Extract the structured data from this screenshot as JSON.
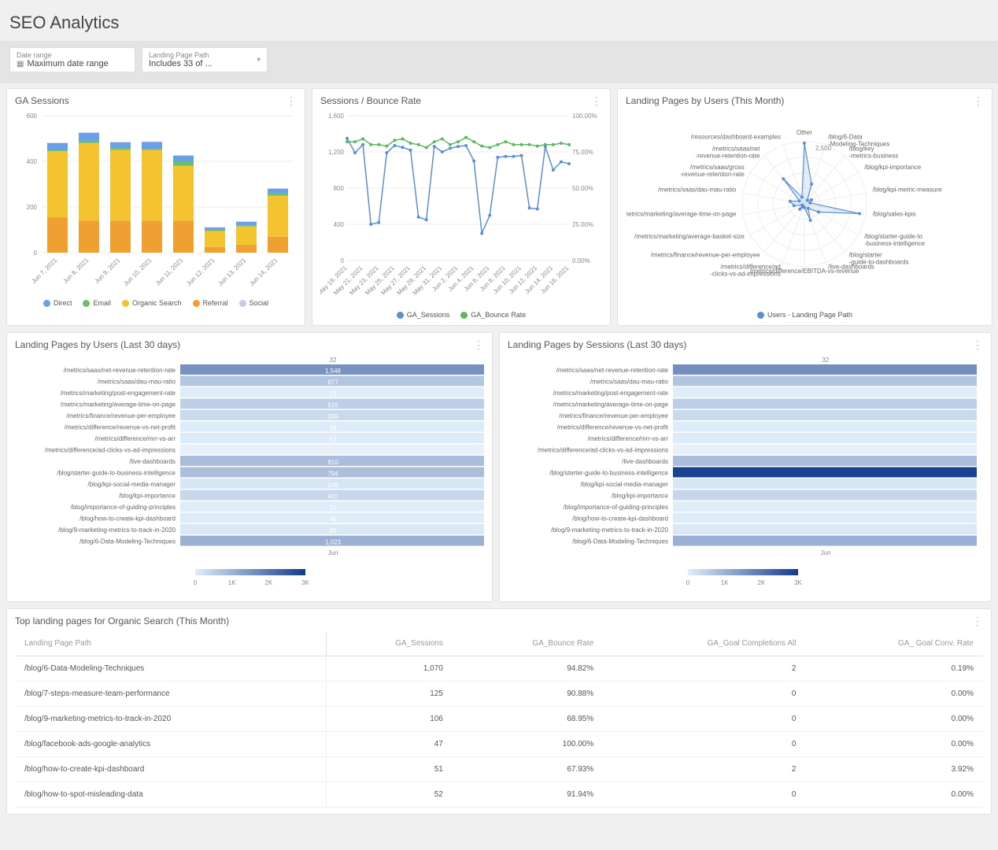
{
  "title": "SEO Analytics",
  "filters": {
    "date_range": {
      "label": "Date range",
      "value": "Maximum date range"
    },
    "landing_page_path": {
      "label": "Landing Page Path",
      "value": "Includes 33 of ..."
    }
  },
  "panels": {
    "ga_sessions": {
      "title": "GA Sessions",
      "legend": [
        "Direct",
        "Email",
        "Organic Search",
        "Referral",
        "Social"
      ],
      "colors": {
        "Direct": "#6aa0e8",
        "Email": "#6abf6a",
        "Organic Search": "#f4c430",
        "Referral": "#f0a030",
        "Social": "#d8c4e6"
      }
    },
    "sessions_bounce": {
      "title": "Sessions / Bounce Rate",
      "legend": [
        "GA_Sessions",
        "GA_Bounce Rate"
      ],
      "colors": {
        "GA_Sessions": "#5a8fd6",
        "GA_Bounce Rate": "#5cb85c"
      }
    },
    "radar": {
      "title": "Landing Pages by Users (This Month)",
      "legend_label": "Users - Landing Page Path",
      "center_tick": "2,500"
    },
    "heatmap_users": {
      "title": "Landing Pages by Users (Last 30 days)"
    },
    "heatmap_sessions": {
      "title": "Landing Pages by Sessions (Last 30 days)"
    },
    "table": {
      "title": "Top landing pages for Organic Search (This Month)"
    }
  },
  "chart_data": {
    "ga_sessions": {
      "type": "bar",
      "stacked": true,
      "ylim": [
        0,
        600
      ],
      "categories": [
        "Jun 7, 2021",
        "Jun 8, 2021",
        "Jun 9, 2021",
        "Jun 10, 2021",
        "Jun 11, 2021",
        "Jun 12, 2021",
        "Jun 13, 2021",
        "Jun 14, 2021"
      ],
      "series": [
        {
          "name": "Referral",
          "values": [
            155,
            140,
            140,
            140,
            140,
            25,
            35,
            70
          ]
        },
        {
          "name": "Organic Search",
          "values": [
            290,
            340,
            310,
            310,
            240,
            70,
            80,
            180
          ]
        },
        {
          "name": "Email",
          "values": [
            5,
            10,
            8,
            5,
            20,
            5,
            5,
            10
          ]
        },
        {
          "name": "Direct",
          "values": [
            30,
            35,
            25,
            30,
            25,
            10,
            15,
            20
          ]
        },
        {
          "name": "Social",
          "values": [
            2,
            2,
            2,
            2,
            2,
            2,
            2,
            2
          ]
        }
      ]
    },
    "sessions_bounce": {
      "type": "line",
      "categories": [
        "May 19, 2021",
        "May 21, 2021",
        "May 23, 2021",
        "May 25, 2021",
        "May 27, 2021",
        "May 29, 2021",
        "May 31, 2021",
        "Jun 2, 2021",
        "Jun 4, 2021",
        "Jun 6, 2021",
        "Jun 8, 2021",
        "Jun 10, 2021",
        "Jun 12, 2021",
        "Jun 14, 2021",
        "Jun 16, 2021"
      ],
      "ylim_left": [
        0,
        1600
      ],
      "ylim_right": [
        0,
        100
      ],
      "series": [
        {
          "name": "GA_Sessions",
          "axis": "left",
          "values": [
            1350,
            1190,
            1280,
            400,
            420,
            1190,
            1270,
            1250,
            1220,
            480,
            450,
            1260,
            1200,
            1240,
            1260,
            1270,
            1100,
            300,
            500,
            1140,
            1150,
            1150,
            1160,
            580,
            570,
            1260,
            1000,
            1090,
            1070
          ]
        },
        {
          "name": "GA_Bounce Rate",
          "axis": "right",
          "values": [
            82,
            82,
            84,
            80,
            80,
            79,
            83,
            84,
            81,
            80,
            78,
            82,
            84,
            80,
            82,
            85,
            82,
            79,
            78,
            80,
            82,
            80,
            80,
            80,
            79,
            80,
            80,
            81,
            80
          ]
        }
      ]
    },
    "radar": {
      "type": "radar",
      "categories": [
        "Other",
        "/blog/6-Data-Modeling-Techniques",
        "/blog/key-metrics-business",
        "/blog/kpi-importance",
        "/blog/kpi-metric-measure",
        "/blog/sales-kpis",
        "/blog/starter-guide-to-business-intelligence",
        "/blog/starter-guide-to-dashboards",
        "/live-dashboards",
        "/metrics/difference/EBITDA-vs-revenue",
        "/metrics/difference/ad-clicks-vs-ad-impressions",
        "/metrics/finance/revenue-per-employee",
        "/metrics/marketing/average-basket-size",
        "/metrics/marketing/average-time-on-page",
        "/metrics/saas/dau-mau-ratio",
        "/metrics/saas/gross-revenue-retention-rate",
        "/metrics/saas/net-revenue-retention-rate",
        "/resources/dashboard-examples"
      ],
      "max": 2700,
      "values": [
        2600,
        900,
        200,
        350,
        250,
        2400,
        700,
        250,
        750,
        150,
        150,
        300,
        100,
        450,
        620,
        250,
        1400,
        300
      ]
    },
    "heatmap_users": {
      "type": "heatmap",
      "col_label": "Jun",
      "top_tick": "32",
      "scale": {
        "min": 0,
        "max": 3000,
        "ticks": [
          "0",
          "1K",
          "2K",
          "3K"
        ]
      },
      "rows": [
        {
          "label": "/metrics/saas/net-revenue-retention-rate",
          "value": 1548
        },
        {
          "label": "/metrics/saas/dau-mau-ratio",
          "value": 677
        },
        {
          "label": "/metrics/marketing/post-engagement-rate",
          "value": 21
        },
        {
          "label": "/metrics/marketing/average-time-on-page",
          "value": 516
        },
        {
          "label": "/metrics/finance/revenue-per-employee",
          "value": 335
        },
        {
          "label": "/metrics/difference/revenue-vs-net-profit",
          "value": 38
        },
        {
          "label": "/metrics/difference/mrr-vs-arr",
          "value": 62
        },
        {
          "label": "/metrics/difference/ad-clicks-vs-ad-impressions",
          "value": null
        },
        {
          "label": "/live-dashboards",
          "value": 810
        },
        {
          "label": "/blog/starter-guide-to-business-intelligence",
          "value": 794
        },
        {
          "label": "/blog/kpi-social-media-manager",
          "value": 149
        },
        {
          "label": "/blog/kpi-importance",
          "value": 402
        },
        {
          "label": "/blog/importance-of-guiding-principles",
          "value": 25
        },
        {
          "label": "/blog/how-to-create-kpi-dashboard",
          "value": 46
        },
        {
          "label": "/blog/9-marketing-metrics-to-track-in-2020",
          "value": 96
        },
        {
          "label": "/blog/6-Data-Modeling-Techniques",
          "value": 1023
        }
      ]
    },
    "heatmap_sessions": {
      "type": "heatmap",
      "col_label": "Jun",
      "top_tick": "32",
      "scale": {
        "min": 0,
        "max": 3000,
        "ticks": [
          "0",
          "1K",
          "2K",
          "3K"
        ]
      },
      "rows": [
        {
          "label": "/metrics/saas/net-revenue-retention-rate",
          "value": 1600
        },
        {
          "label": "/metrics/saas/dau-mau-ratio",
          "value": 700
        },
        {
          "label": "/metrics/marketing/post-engagement-rate",
          "value": 25
        },
        {
          "label": "/metrics/marketing/average-time-on-page",
          "value": 520
        },
        {
          "label": "/metrics/finance/revenue-per-employee",
          "value": 340
        },
        {
          "label": "/metrics/difference/revenue-vs-net-profit",
          "value": 40
        },
        {
          "label": "/metrics/difference/mrr-vs-arr",
          "value": 65
        },
        {
          "label": "/metrics/difference/ad-clicks-vs-ad-impressions",
          "value": null
        },
        {
          "label": "/live-dashboards",
          "value": 820
        },
        {
          "label": "/blog/starter-guide-to-business-intelligence",
          "value": 2900
        },
        {
          "label": "/blog/kpi-social-media-manager",
          "value": 150
        },
        {
          "label": "/blog/kpi-importance",
          "value": 410
        },
        {
          "label": "/blog/importance-of-guiding-principles",
          "value": 25
        },
        {
          "label": "/blog/how-to-create-kpi-dashboard",
          "value": 50
        },
        {
          "label": "/blog/9-marketing-metrics-to-track-in-2020",
          "value": 100
        },
        {
          "label": "/blog/6-Data-Modeling-Techniques",
          "value": 1050
        }
      ]
    },
    "table": {
      "type": "table",
      "columns": [
        "Landing Page Path",
        "GA_Sessions",
        "GA_Bounce Rate",
        "GA_Goal Completions All",
        "GA_ Goal Conv. Rate"
      ],
      "rows": [
        [
          "/blog/6-Data-Modeling-Techniques",
          "1,070",
          "94.82%",
          "2",
          "0.19%"
        ],
        [
          "/blog/7-steps-measure-team-performance",
          "125",
          "90.88%",
          "0",
          "0.00%"
        ],
        [
          "/blog/9-marketing-metrics-to-track-in-2020",
          "106",
          "68.95%",
          "0",
          "0.00%"
        ],
        [
          "/blog/facebook-ads-google-analytics",
          "47",
          "100.00%",
          "0",
          "0.00%"
        ],
        [
          "/blog/how-to-create-kpi-dashboard",
          "51",
          "67.93%",
          "2",
          "3.92%"
        ],
        [
          "/blog/how-to-spot-misleading-data",
          "52",
          "91.94%",
          "0",
          "0.00%"
        ]
      ]
    }
  }
}
